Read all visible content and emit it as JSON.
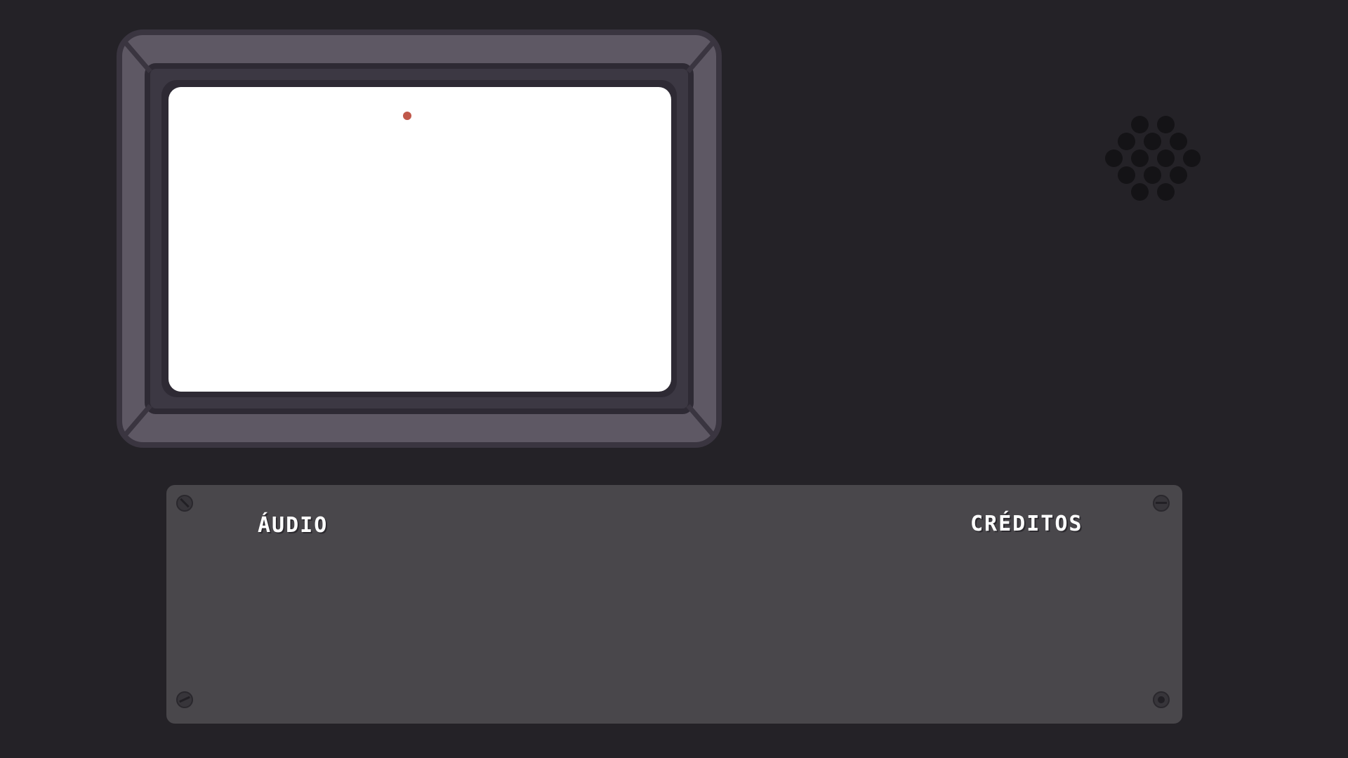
{
  "panel": {
    "audio_label": "ÁUDIO",
    "credits_label": "CRÉDITOS"
  },
  "colors": {
    "background": "#242227",
    "bezel_outer": "#5e5864",
    "bezel_inner": "#3c3843",
    "screen": "#ffffff",
    "power_led": "#c0584a",
    "panel": "#49474b"
  },
  "icons": {
    "speaker": "speaker-grille-icon",
    "led": "power-led-icon",
    "screw": "screw-icon"
  }
}
